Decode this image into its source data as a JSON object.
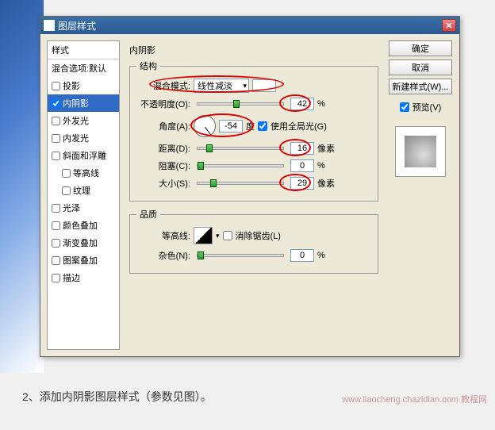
{
  "dialog": {
    "title": "图层样式"
  },
  "styleList": {
    "header": "样式",
    "blendOptions": "混合选项:默认",
    "items": [
      "投影",
      "内阴影",
      "外发光",
      "内发光",
      "斜面和浮雕",
      "等高线",
      "纹理",
      "光泽",
      "颜色叠加",
      "渐变叠加",
      "图案叠加",
      "描边"
    ],
    "selectedIndex": 1
  },
  "panel": {
    "title": "内阴影",
    "group1Legend": "结构",
    "blendModeLabel": "混合模式:",
    "blendModeValue": "线性减淡",
    "opacityLabel": "不透明度(O):",
    "opacityValue": "42",
    "angleLabel": "角度(A):",
    "angleValue": "-54",
    "angleUnit": "度",
    "globalLightLabel": "使用全局光(G)",
    "distanceLabel": "距离(D):",
    "distanceValue": "16",
    "pxUnit": "像素",
    "chokeLabel": "阻塞(C):",
    "chokeValue": "0",
    "percent": "%",
    "sizeLabel": "大小(S):",
    "sizeValue": "29",
    "group2Legend": "品质",
    "contourLabel": "等高线:",
    "antiAliasLabel": "消除锯齿(L)",
    "noiseLabel": "杂色(N):",
    "noiseValue": "0"
  },
  "buttons": {
    "ok": "确定",
    "cancel": "取消",
    "newStyle": "新建样式(W)...",
    "previewLabel": "预览(V)"
  },
  "step": "2、添加内阴影图层样式（参数见图）。",
  "watermark": "www.liaocheng.chazidian.com 教程网"
}
